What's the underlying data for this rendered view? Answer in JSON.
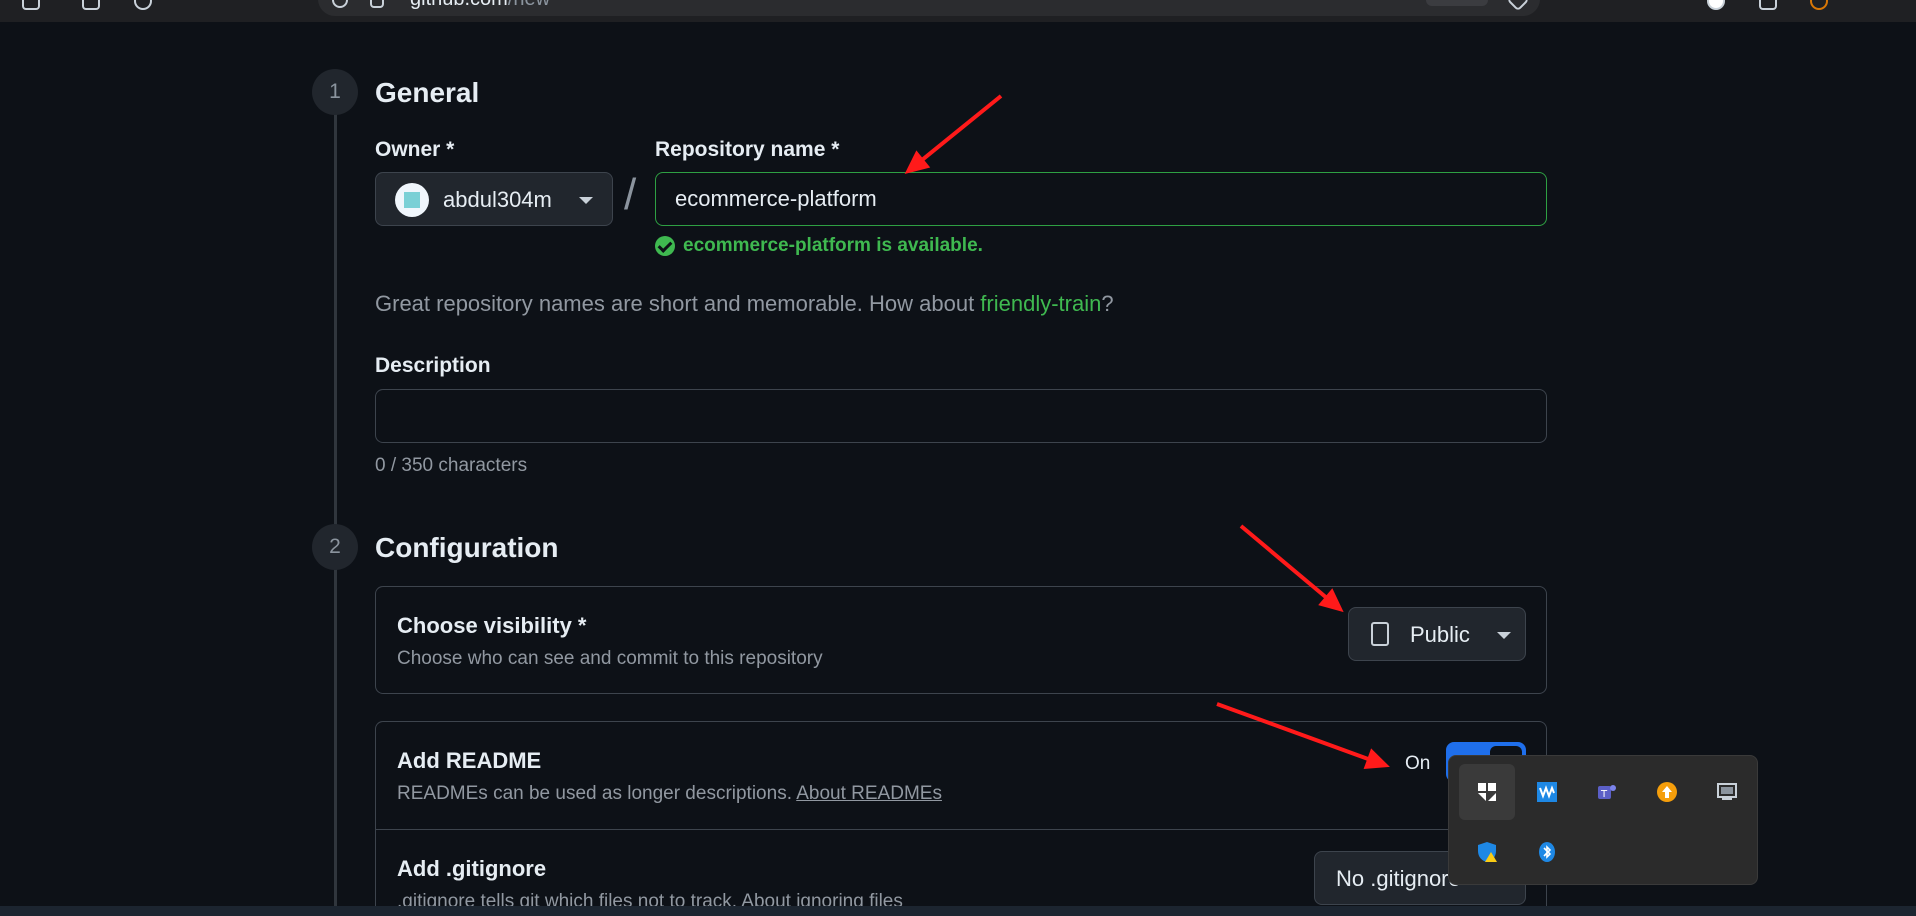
{
  "browser": {
    "url_host": "github.com",
    "url_path": "/new"
  },
  "general": {
    "step_number": "1",
    "title": "General",
    "owner_label": "Owner *",
    "owner_value": "abdul304m",
    "separator": "/",
    "repo_name_label": "Repository name *",
    "repo_name_value": "ecommerce-platform",
    "availability": "ecommerce-platform is available.",
    "hint_prefix": "Great repository names are short and memorable. How about ",
    "hint_suggestion": "friendly-train",
    "hint_suffix": "?",
    "description_label": "Description",
    "description_value": "",
    "char_count": "0 / 350 characters"
  },
  "configuration": {
    "step_number": "2",
    "title": "Configuration",
    "visibility_title": "Choose visibility *",
    "visibility_desc": "Choose who can see and commit to this repository",
    "visibility_value": "Public",
    "readme_title": "Add README",
    "readme_desc": "READMEs can be used as longer descriptions. ",
    "readme_link": "About READMEs",
    "readme_toggle_label": "On",
    "readme_enabled": true,
    "gitignore_title": "Add .gitignore",
    "gitignore_desc": ".gitignore tells git which files not to track. About ignoring files",
    "gitignore_value": "No .gitignore"
  },
  "tray": {
    "icons": [
      "pinned-app-icon",
      "waves-app-icon",
      "teams-icon",
      "update-arrow-icon",
      "display-icon",
      "security-warning-icon",
      "bluetooth-icon"
    ]
  },
  "colors": {
    "background": "#0d1117",
    "success": "#3fb950",
    "accent": "#1f6feb",
    "annotation_arrow": "#ff1a1a"
  }
}
